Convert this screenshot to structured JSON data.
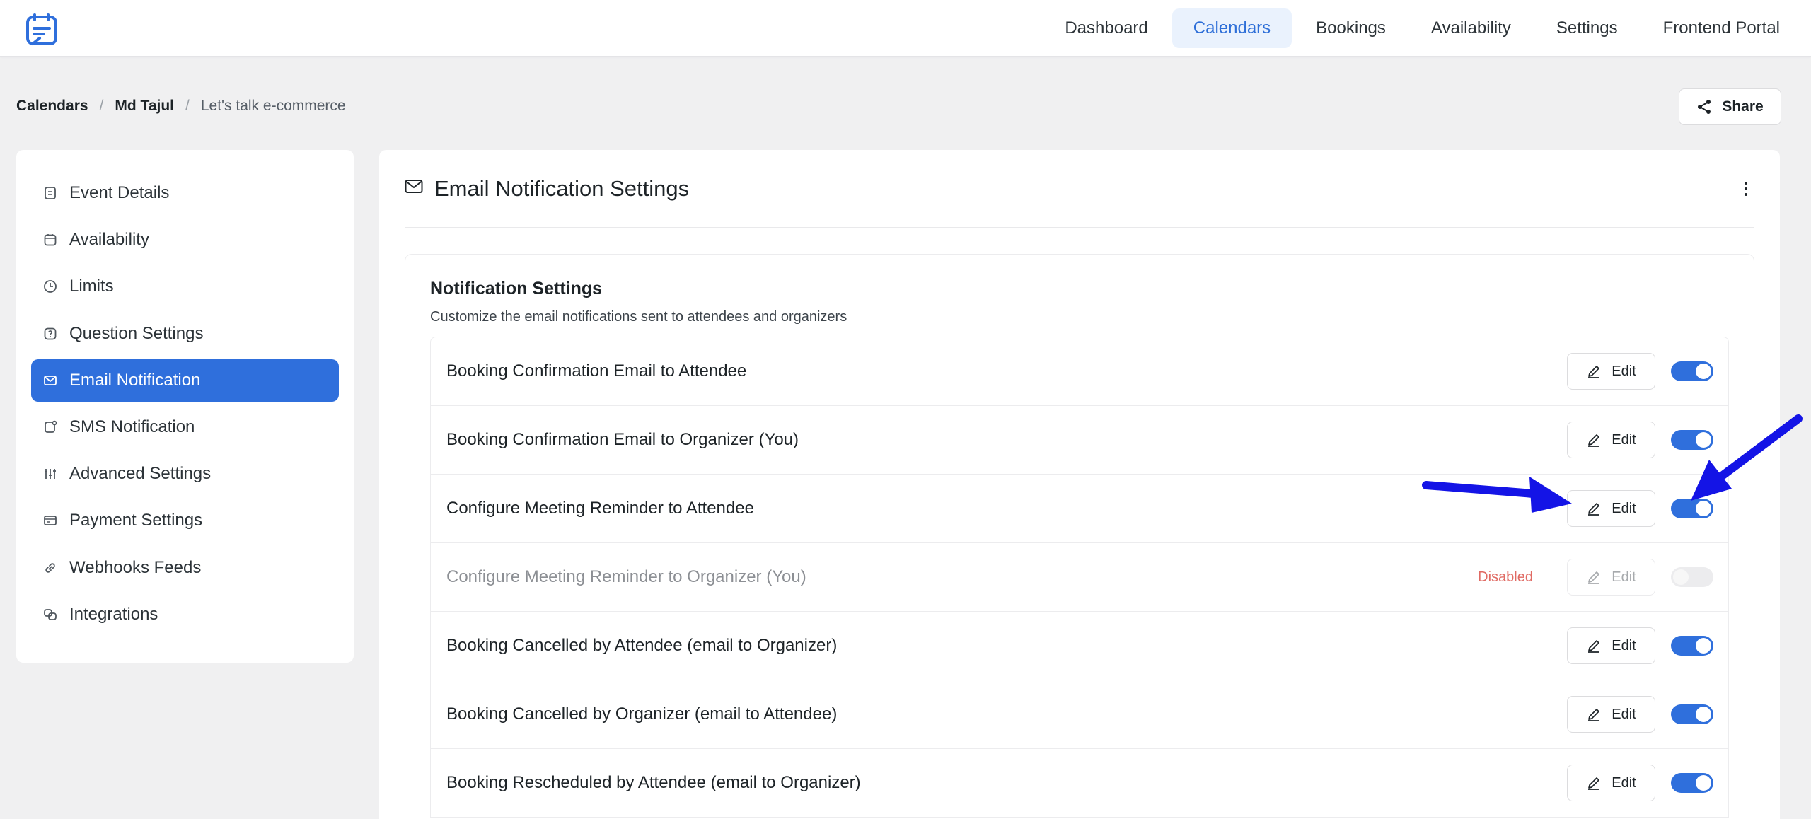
{
  "nav": {
    "items": [
      {
        "label": "Dashboard",
        "active": false
      },
      {
        "label": "Calendars",
        "active": true
      },
      {
        "label": "Bookings",
        "active": false
      },
      {
        "label": "Availability",
        "active": false
      },
      {
        "label": "Settings",
        "active": false
      },
      {
        "label": "Frontend Portal",
        "active": false
      }
    ]
  },
  "breadcrumb": {
    "first": "Calendars",
    "second": "Md Tajul",
    "current": "Let's talk e-commerce",
    "separator": "/"
  },
  "share_label": "Share",
  "sidebar": {
    "items": [
      {
        "label": "Event Details",
        "icon": "document-icon"
      },
      {
        "label": "Availability",
        "icon": "calendar-icon"
      },
      {
        "label": "Limits",
        "icon": "clock-icon"
      },
      {
        "label": "Question Settings",
        "icon": "question-icon"
      },
      {
        "label": "Email Notification",
        "icon": "mail-icon",
        "active": true
      },
      {
        "label": "SMS Notification",
        "icon": "sms-icon"
      },
      {
        "label": "Advanced Settings",
        "icon": "sliders-icon"
      },
      {
        "label": "Payment Settings",
        "icon": "payment-icon"
      },
      {
        "label": "Webhooks Feeds",
        "icon": "link-icon"
      },
      {
        "label": "Integrations",
        "icon": "integrations-icon"
      }
    ]
  },
  "main": {
    "title": "Email Notification Settings",
    "card_title": "Notification Settings",
    "card_subtitle": "Customize the email notifications sent to attendees and organizers",
    "edit_label": "Edit",
    "disabled_label": "Disabled",
    "rows": [
      {
        "label": "Booking Confirmation Email to Attendee",
        "enabled": true
      },
      {
        "label": "Booking Confirmation Email to Organizer (You)",
        "enabled": true
      },
      {
        "label": "Configure Meeting Reminder to Attendee",
        "enabled": true
      },
      {
        "label": "Configure Meeting Reminder to Organizer (You)",
        "enabled": false
      },
      {
        "label": "Booking Cancelled by Attendee (email to Organizer)",
        "enabled": true
      },
      {
        "label": "Booking Cancelled by Organizer (email to Attendee)",
        "enabled": true
      },
      {
        "label": "Booking Rescheduled by Attendee (email to Organizer)",
        "enabled": true
      }
    ]
  },
  "colors": {
    "accent": "#2f6fdc",
    "nav_active_bg": "#eaf2fd",
    "disabled_text": "#e06a63",
    "annotation_arrow": "#1414e6"
  }
}
